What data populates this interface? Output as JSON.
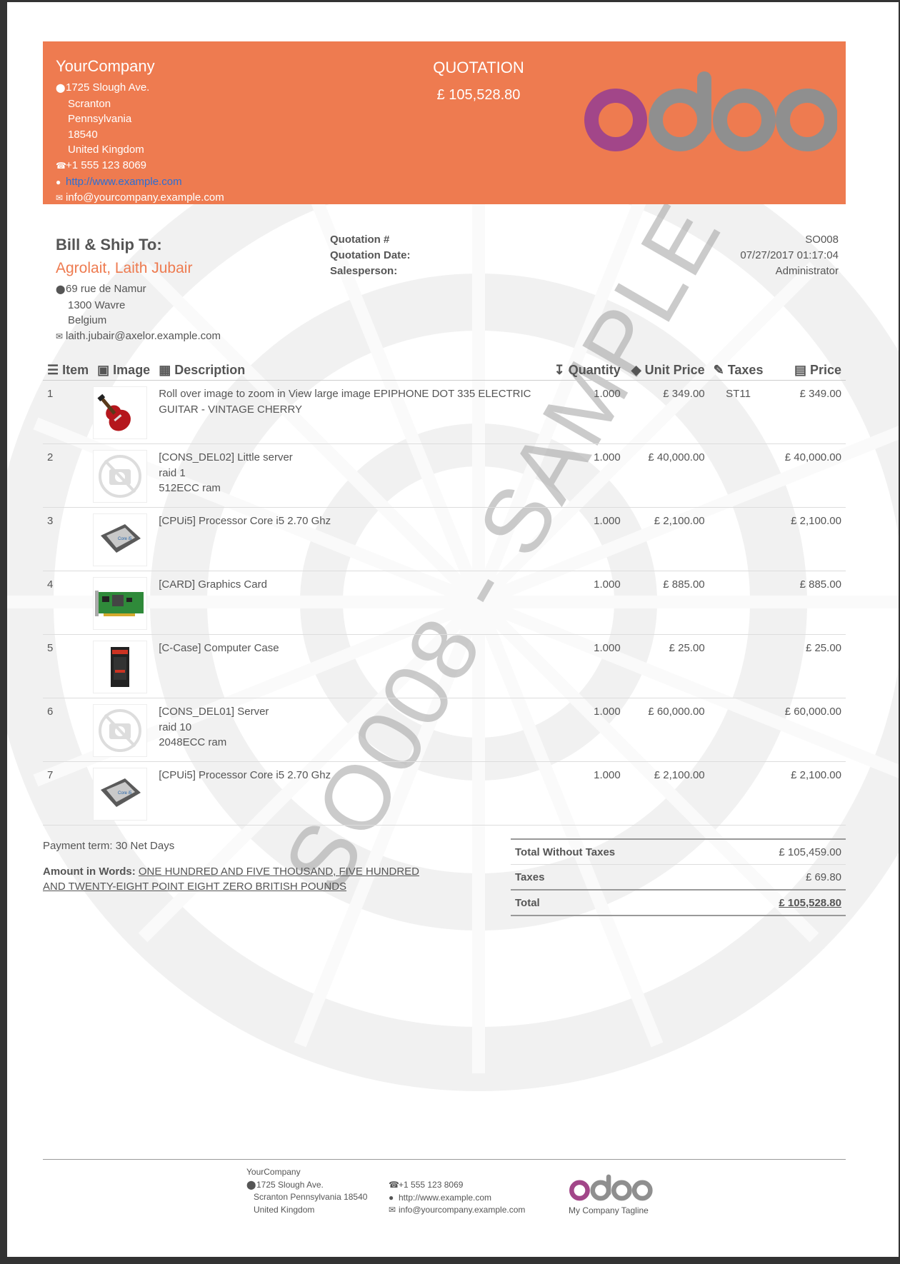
{
  "company": {
    "name": "YourCompany",
    "street": "1725 Slough Ave.",
    "city": "Scranton",
    "state": "Pennsylvania",
    "zip": "18540",
    "country": "United Kingdom",
    "phone": "+1 555 123 8069",
    "website": "http://www.example.com",
    "email": "info@yourcompany.example.com"
  },
  "document": {
    "title": "QUOTATION",
    "total": "£ 105,528.80",
    "watermark": "SO008 - SAMPLE"
  },
  "customer": {
    "heading": "Bill & Ship To:",
    "name": "Agrolait, Laith Jubair",
    "street": "69 rue de Namur",
    "city": "1300 Wavre",
    "country": "Belgium",
    "email": "laith.jubair@axelor.example.com"
  },
  "meta": {
    "number_label": "Quotation #",
    "number": "SO008",
    "date_label": "Quotation Date:",
    "date": "07/27/2017 01:17:04",
    "salesperson_label": "Salesperson:",
    "salesperson": "Administrator"
  },
  "columns": {
    "item": "Item",
    "image": "Image",
    "description": "Description",
    "quantity": "Quantity",
    "unit_price": "Unit Price",
    "taxes": "Taxes",
    "price": "Price"
  },
  "lines": [
    {
      "item": "1",
      "image": "guitar",
      "desc": [
        "Roll over image to zoom in View large image EPIPHONE DOT 335 ELECTRIC",
        "GUITAR - VINTAGE CHERRY"
      ],
      "qty": "1.000",
      "unit": "£ 349.00",
      "tax": "ST11",
      "price": "£ 349.00"
    },
    {
      "item": "2",
      "image": "no-image",
      "desc": [
        "[CONS_DEL02] Little server",
        "raid 1",
        "512ECC ram"
      ],
      "qty": "1.000",
      "unit": "£ 40,000.00",
      "tax": "",
      "price": "£ 40,000.00"
    },
    {
      "item": "3",
      "image": "cpu",
      "desc": [
        "[CPUi5] Processor Core i5 2.70 Ghz"
      ],
      "qty": "1.000",
      "unit": "£ 2,100.00",
      "tax": "",
      "price": "£ 2,100.00"
    },
    {
      "item": "4",
      "image": "graphics-card",
      "desc": [
        "[CARD] Graphics Card"
      ],
      "qty": "1.000",
      "unit": "£ 885.00",
      "tax": "",
      "price": "£ 885.00"
    },
    {
      "item": "5",
      "image": "computer-case",
      "desc": [
        "[C-Case] Computer Case"
      ],
      "qty": "1.000",
      "unit": "£ 25.00",
      "tax": "",
      "price": "£ 25.00"
    },
    {
      "item": "6",
      "image": "no-image",
      "desc": [
        "[CONS_DEL01] Server",
        "raid 10",
        "2048ECC ram"
      ],
      "qty": "1.000",
      "unit": "£ 60,000.00",
      "tax": "",
      "price": "£ 60,000.00"
    },
    {
      "item": "7",
      "image": "cpu",
      "desc": [
        "[CPUi5] Processor Core i5 2.70 Ghz"
      ],
      "qty": "1.000",
      "unit": "£ 2,100.00",
      "tax": "",
      "price": "£ 2,100.00"
    }
  ],
  "payment_term": "Payment term: 30 Net Days",
  "amount_words_label": "Amount in Words:",
  "amount_words_line1": "ONE HUNDRED AND FIVE THOUSAND, FIVE HUNDRED",
  "amount_words_line2": "AND TWENTY-EIGHT POINT EIGHT ZERO BRITISH POUNDS",
  "totals": {
    "untaxed_label": "Total Without Taxes",
    "untaxed": "£ 105,459.00",
    "taxes_label": "Taxes",
    "taxes": "£ 69.80",
    "total_label": "Total",
    "total": "£ 105,528.80"
  },
  "footer": {
    "company": "YourCompany",
    "street": "1725 Slough Ave.",
    "city_line": "Scranton Pennsylvania 18540",
    "country": "United Kingdom",
    "phone": "+1 555 123 8069",
    "website": "http://www.example.com",
    "email": "info@yourcompany.example.com",
    "tagline": "My Company Tagline"
  },
  "colors": {
    "header_bg": "#ee7b50",
    "accent": "#ee7b50",
    "logo_o_first": "#a24689",
    "logo_grey": "#8f8f8f"
  }
}
